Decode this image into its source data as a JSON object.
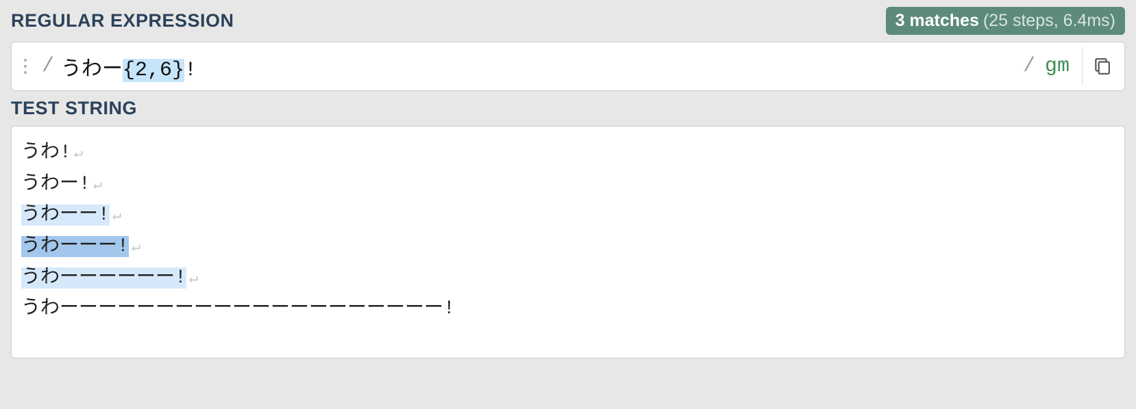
{
  "labels": {
    "regex_section": "REGULAR EXPRESSION",
    "test_section": "TEST STRING"
  },
  "match_info": {
    "count_label": "3 matches",
    "detail": "(25 steps, 6.4ms)"
  },
  "regex": {
    "open_delim": "/",
    "close_delim": "/",
    "flags": "gm",
    "pattern_plain": "うわー",
    "pattern_quant": "{2,6}",
    "pattern_tail": "!"
  },
  "test_lines": [
    {
      "pre": "",
      "match": "",
      "post": "うわ!",
      "hl": "",
      "newline": true
    },
    {
      "pre": "",
      "match": "",
      "post": "うわー!",
      "hl": "",
      "newline": true
    },
    {
      "pre": "",
      "match": "うわーー!",
      "post": "",
      "hl": "light",
      "newline": true
    },
    {
      "pre": "",
      "match": "うわーーー!",
      "post": "",
      "hl": "dark",
      "newline": true
    },
    {
      "pre": "",
      "match": "うわーーーーーー!",
      "post": "",
      "hl": "light",
      "newline": true
    },
    {
      "pre": "",
      "match": "",
      "post": "うわーーーーーーーーーーーーーーーーーーーー!",
      "hl": "",
      "newline": false
    }
  ]
}
